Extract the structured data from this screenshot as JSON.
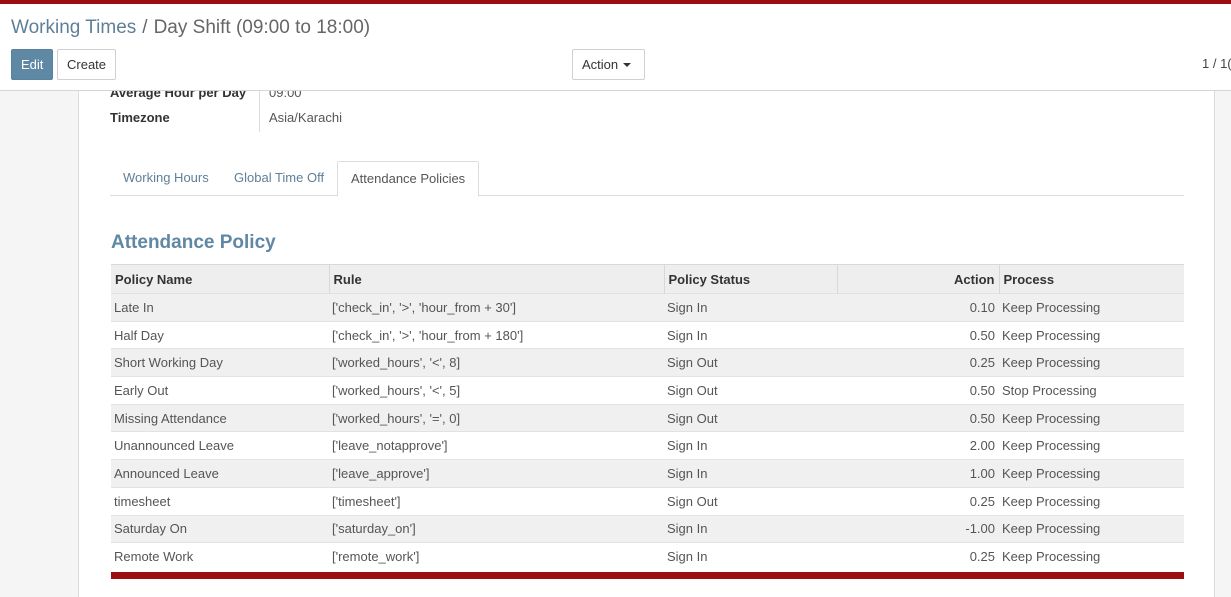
{
  "breadcrumb": {
    "parent": "Working Times",
    "separator": "/",
    "current": "Day Shift (09:00 to 18:00)"
  },
  "buttons": {
    "edit": "Edit",
    "create": "Create",
    "action": "Action"
  },
  "pager": "1 / 1(",
  "fields": [
    {
      "label": "Average Hour per Day",
      "value": "09:00"
    },
    {
      "label": "Timezone",
      "value": "Asia/Karachi"
    }
  ],
  "tabs": [
    {
      "label": "Working Hours",
      "active": false
    },
    {
      "label": "Global Time Off",
      "active": false
    },
    {
      "label": "Attendance Policies",
      "active": true
    }
  ],
  "section_title": "Attendance Policy",
  "table": {
    "headers": [
      "Policy Name",
      "Rule",
      "Policy Status",
      "Action",
      "Process"
    ],
    "rows": [
      [
        "Late In",
        "['check_in', '>', 'hour_from + 30']",
        "Sign In",
        "0.10",
        "Keep Processing"
      ],
      [
        "Half Day",
        "['check_in', '>', 'hour_from + 180']",
        "Sign In",
        "0.50",
        "Keep Processing"
      ],
      [
        "Short Working Day",
        "['worked_hours', '<', 8]",
        "Sign Out",
        "0.25",
        "Keep Processing"
      ],
      [
        "Early Out",
        "['worked_hours', '<', 5]",
        "Sign Out",
        "0.50",
        "Stop Processing"
      ],
      [
        "Missing Attendance",
        "['worked_hours', '=', 0]",
        "Sign Out",
        "0.50",
        "Keep Processing"
      ],
      [
        "Unannounced Leave",
        "['leave_notapprove']",
        "Sign In",
        "2.00",
        "Keep Processing"
      ],
      [
        "Announced Leave",
        "['leave_approve']",
        "Sign In",
        "1.00",
        "Keep Processing"
      ],
      [
        "timesheet",
        "['timesheet']",
        "Sign Out",
        "0.25",
        "Keep Processing"
      ],
      [
        "Saturday On",
        "['saturday_on']",
        "Sign In",
        "-1.00",
        "Keep Processing"
      ],
      [
        "Remote Work",
        "['remote_work']",
        "Sign In",
        "0.25",
        "Keep Processing"
      ]
    ]
  },
  "colors": {
    "accent": "#9b0e0f",
    "primary": "#5f88a4",
    "link": "#5f7f97"
  }
}
